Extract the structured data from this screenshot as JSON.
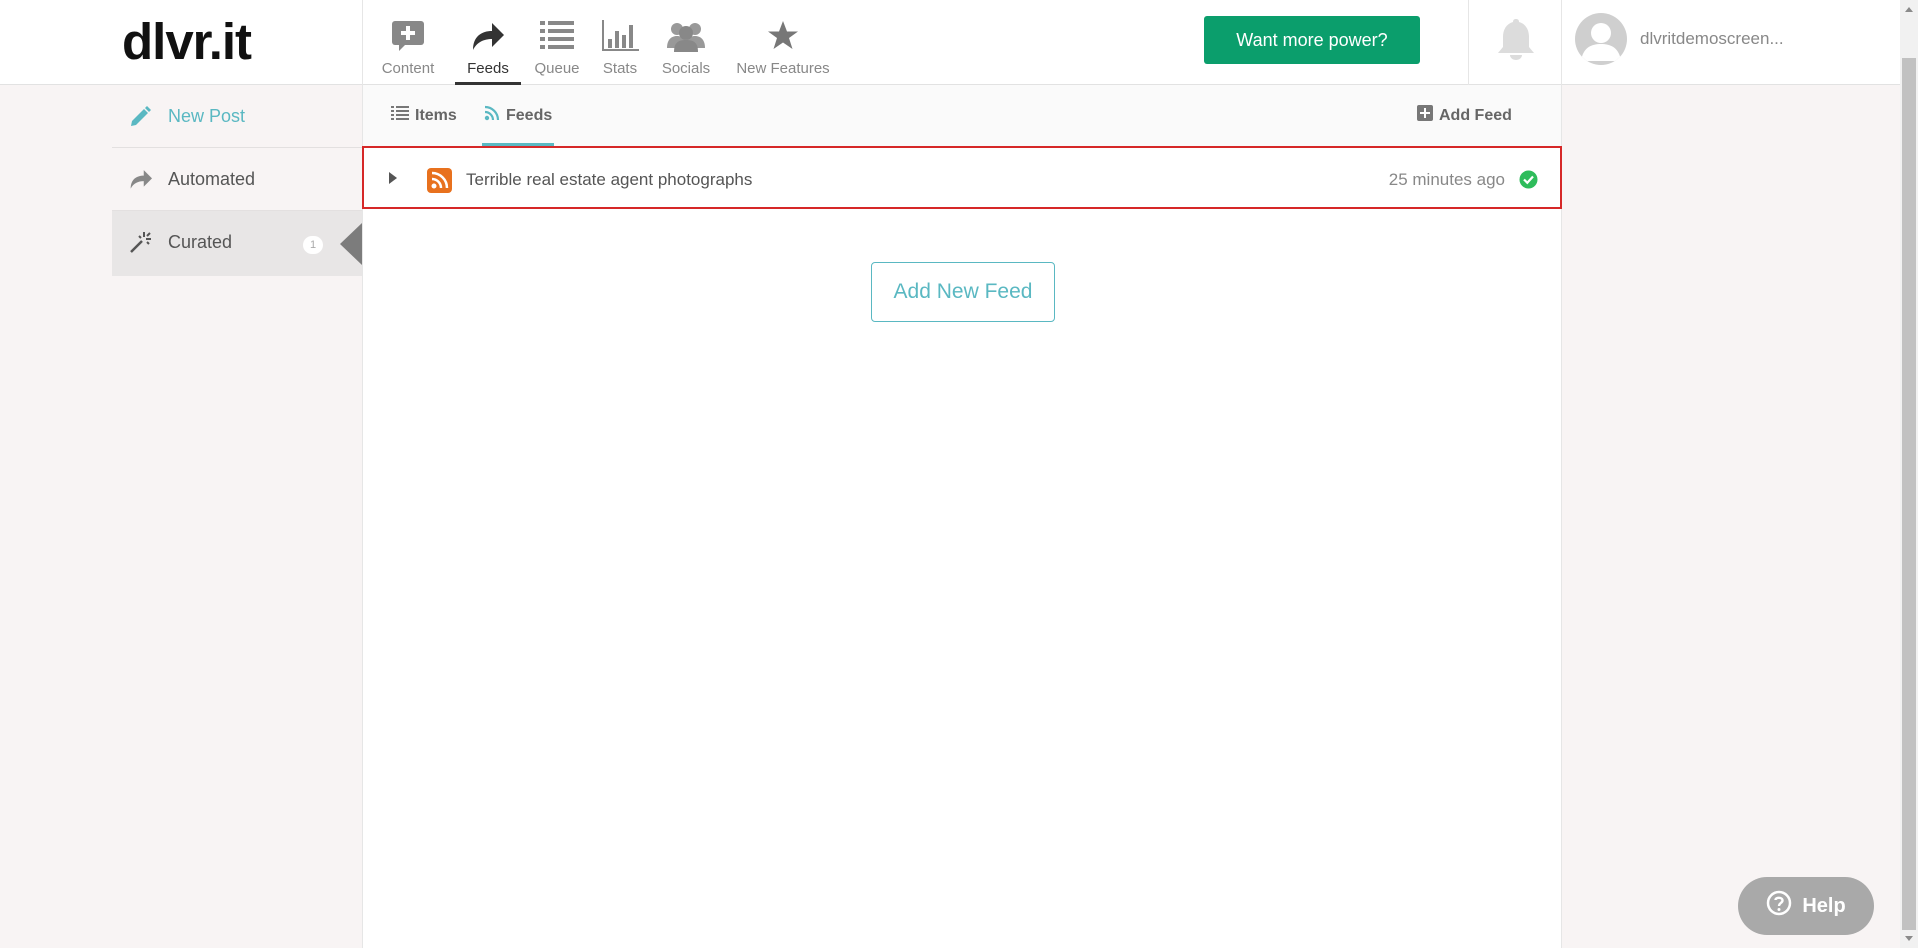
{
  "app": {
    "logo": "dlvr.it"
  },
  "nav": {
    "items": [
      {
        "label": "Content",
        "icon": "plus-bubble-icon",
        "active": false
      },
      {
        "label": "Feeds",
        "icon": "share-arrow-icon",
        "active": true
      },
      {
        "label": "Queue",
        "icon": "list-icon",
        "active": false
      },
      {
        "label": "Stats",
        "icon": "bar-chart-icon",
        "active": false
      },
      {
        "label": "Socials",
        "icon": "people-icon",
        "active": false
      },
      {
        "label": "New Features",
        "icon": "star-icon",
        "active": false
      }
    ]
  },
  "header": {
    "power_button": "Want more power?",
    "username": "dlvritdemoscreen..."
  },
  "sidebar": {
    "items": [
      {
        "label": "New Post",
        "icon": "pencil-icon"
      },
      {
        "label": "Automated",
        "icon": "share-arrow-icon"
      },
      {
        "label": "Curated",
        "icon": "magic-wand-icon",
        "badge": "1",
        "selected": true
      }
    ]
  },
  "tabs": {
    "items_label": "Items",
    "feeds_label": "Feeds",
    "add_feed_label": "Add Feed"
  },
  "feed": {
    "title": "Terrible real estate agent photographs",
    "time": "25 minutes ago",
    "status": "ok"
  },
  "main": {
    "add_new_feed": "Add New Feed"
  },
  "help": {
    "label": "Help"
  },
  "colors": {
    "accent": "#5ab8c2",
    "power_button": "#0b9e6c",
    "rss": "#e8711e",
    "status_ok": "#2ebc5b",
    "highlight_border": "#d62828"
  }
}
